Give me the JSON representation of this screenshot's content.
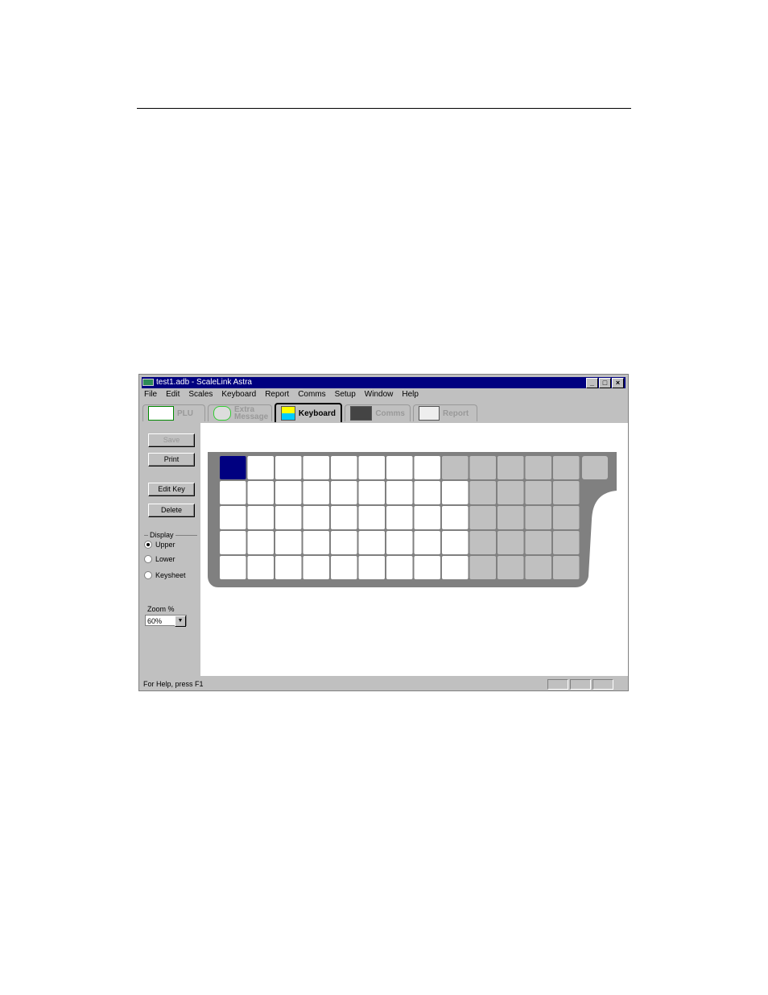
{
  "window": {
    "title": "test1.adb - ScaleLink Astra",
    "buttons": [
      "_",
      "□",
      "×"
    ]
  },
  "menu": [
    "File",
    "Edit",
    "Scales",
    "Keyboard",
    "Report",
    "Comms",
    "Setup",
    "Window",
    "Help"
  ],
  "tabs": [
    {
      "label": "PLU",
      "icon": "plu-label-icon",
      "active": false
    },
    {
      "label": "Extra Message",
      "icon": "message-magnifier-icon",
      "active": false
    },
    {
      "label": "Keyboard",
      "icon": "keyboard-icon",
      "active": true
    },
    {
      "label": "Comms",
      "icon": "comms-device-icon",
      "active": false
    },
    {
      "label": "Report",
      "icon": "report-sheet-icon",
      "active": false
    }
  ],
  "left": {
    "save": "Save",
    "print": "Print",
    "edit_key": "Edit Key",
    "delete": "Delete",
    "display_label": "Display",
    "radios": [
      {
        "label": "Upper",
        "checked": true
      },
      {
        "label": "Lower",
        "checked": false
      },
      {
        "label": "Keysheet",
        "checked": false
      }
    ],
    "zoom_label": "Zoom %",
    "zoom_value": "60%"
  },
  "keyboard": {
    "colors": {
      "selected": "#000080",
      "active": "#ffffff",
      "inactive": "#c0c0c0",
      "body": "#808080"
    },
    "rows": [
      [
        "selected",
        "active",
        "active",
        "active",
        "active",
        "active",
        "active",
        "active",
        "inactive",
        "inactive",
        "inactive",
        "inactive",
        "inactive"
      ],
      [
        "active",
        "active",
        "active",
        "active",
        "active",
        "active",
        "active",
        "active",
        "active",
        "inactive",
        "inactive",
        "inactive",
        "inactive"
      ],
      [
        "active",
        "active",
        "active",
        "active",
        "active",
        "active",
        "active",
        "active",
        "active",
        "inactive",
        "inactive",
        "inactive",
        "inactive"
      ],
      [
        "active",
        "active",
        "active",
        "active",
        "active",
        "active",
        "active",
        "active",
        "active",
        "inactive",
        "inactive",
        "inactive",
        "inactive"
      ],
      [
        "active",
        "active",
        "active",
        "active",
        "active",
        "active",
        "active",
        "active",
        "active",
        "inactive",
        "inactive",
        "inactive",
        "inactive"
      ]
    ],
    "extra_key": "inactive"
  },
  "status": {
    "text": "For Help, press F1"
  }
}
